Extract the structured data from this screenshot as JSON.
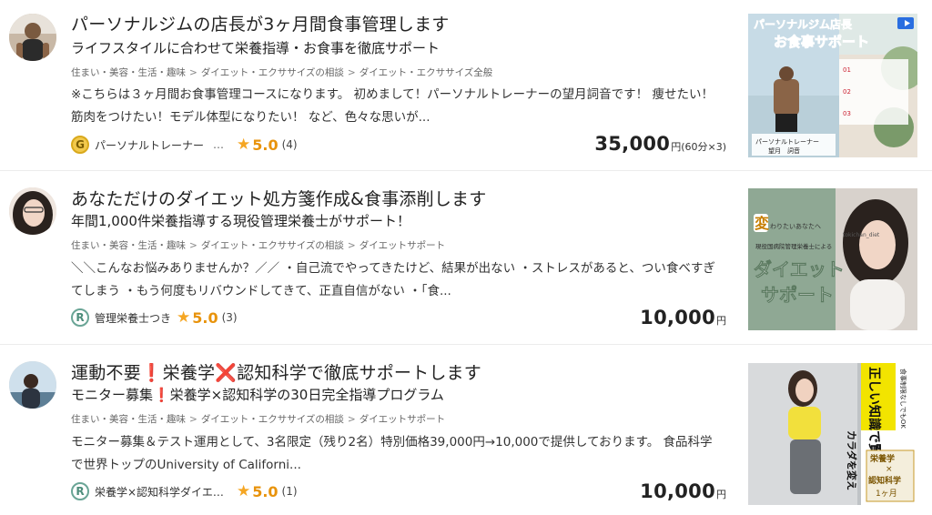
{
  "listings": [
    {
      "title": "パーソナルジムの店長が3ヶ月間食事管理します",
      "subtitle": "ライフスタイルに合わせて栄養指導・お食事を徹底サポート",
      "breadcrumbs": [
        "住まい・美容・生活・趣味",
        "ダイエット・エクササイズの相談",
        "ダイエット・エクササイズ全般"
      ],
      "description": [
        "※こちらは３ヶ月間お食事管理コースになります。 初めまして！パーソナルトレーナーの望月詞音です！ 痩せたい！",
        "筋肉をつけたい！モデル体型になりたい！ など、色々な思いが..."
      ],
      "seller": {
        "rank": "G",
        "name": "パーソナルトレーナー",
        "more": "…"
      },
      "rating": {
        "star": "★",
        "score": "5.0",
        "count": "(4)"
      },
      "price": {
        "amount": "35,000",
        "unit": "円(60分×3)"
      },
      "thumb": {
        "heading1": "パーソナルジム店長",
        "heading2": "お食事サポート",
        "caption1": "パーソナルトレーナー",
        "caption2": "望月　詞音",
        "list": [
          "01",
          "02",
          "03"
        ],
        "video_icon": "video-camera-icon"
      }
    },
    {
      "title": "あなただけのダイエット処方箋作成&食事添削します",
      "subtitle": "年間1,000件栄養指導する現役管理栄養士がサポート！",
      "breadcrumbs": [
        "住まい・美容・生活・趣味",
        "ダイエット・エクササイズの相談",
        "ダイエットサポート"
      ],
      "description": [
        "＼＼こんなお悩みありませんか？／／ ・自己流でやってきたけど、結果が出ない ・ストレスがあると、つい食べすぎ",
        "てしまう ・もう何度もリバウンドしてきて、正直自信がない ・「食..."
      ],
      "seller": {
        "rank": "R",
        "name": "管理栄養士つき"
      },
      "rating": {
        "star": "★",
        "score": "5.0",
        "count": "(3)"
      },
      "price": {
        "amount": "10,000",
        "unit": "円"
      },
      "thumb": {
        "big": "変",
        "small": "わりたいあなたへ",
        "tag": "tokichan_diet",
        "sub": "現役国病院管理栄養士による",
        "line1": "ダイエット",
        "line2": "サポート"
      }
    },
    {
      "title": "運動不要❗栄養学❌認知科学で徹底サポートします",
      "subtitle": "モニター募集❗栄養学×認知科学の30日完全指導プログラム",
      "breadcrumbs": [
        "住まい・美容・生活・趣味",
        "ダイエット・エクササイズの相談",
        "ダイエットサポート"
      ],
      "description": [
        "モニター募集＆テスト運用として、3名限定（残り2名）特別価格39,000円→10,000で提供しております。 食品科学",
        "で世界トップのUniversity of Californi..."
      ],
      "seller": {
        "rank": "R",
        "name": "栄養学×認知科学ダイエ…"
      },
      "rating": {
        "star": "★",
        "score": "5.0",
        "count": "(1)"
      },
      "price": {
        "amount": "10,000",
        "unit": "円"
      },
      "thumb": {
        "side": "食事制限なしでもOK",
        "banner": "正しい知識で賢く",
        "vertical": "カラダを変え",
        "box1": "栄養学",
        "box2": "×",
        "box3": "認知科学",
        "box4": "1ヶ月"
      }
    }
  ],
  "colors": {
    "star": "#f5a623",
    "gold_rank": "#f2c94c",
    "regular_rank": "#6aa596",
    "thumb2_green": "#8fa894"
  }
}
